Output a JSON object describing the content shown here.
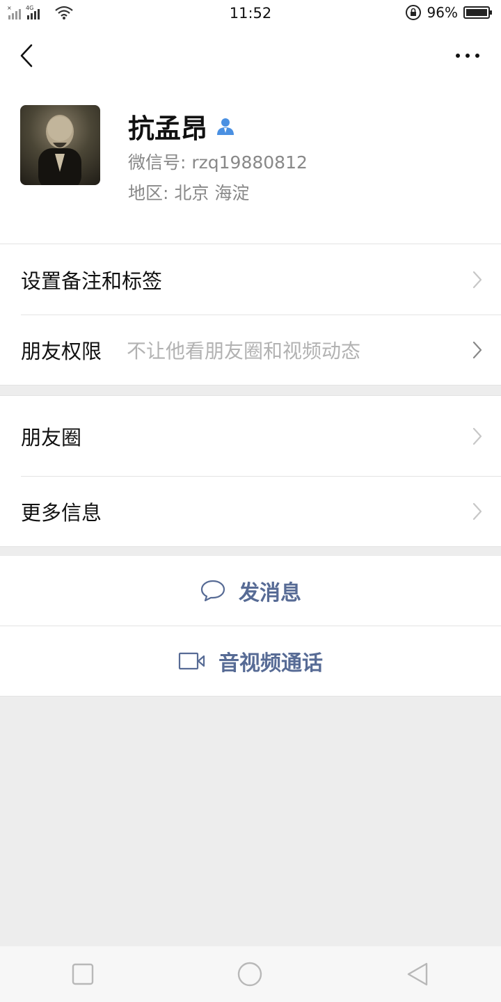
{
  "status_bar": {
    "time": "11:52",
    "network": "4G",
    "battery": "96%"
  },
  "nav": {
    "back_icon": "chevron-left-icon",
    "more_icon": "more-dots-icon"
  },
  "profile": {
    "name": "抗孟昂",
    "wechat_id": "微信号:  rzq19880812",
    "region": "地区:  北京  海淀",
    "contact_icon": "person-icon",
    "contact_icon_color": "#4a90e2"
  },
  "settings": {
    "remark_tags": "设置备注和标签",
    "friend_permission": "朋友权限",
    "friend_permission_value": "不让他看朋友圈和视频动态"
  },
  "info": {
    "moments": "朋友圈",
    "more_info": "更多信息"
  },
  "actions": {
    "send_message": "发消息",
    "video_call": "音视频通话",
    "color": "#576b95"
  }
}
